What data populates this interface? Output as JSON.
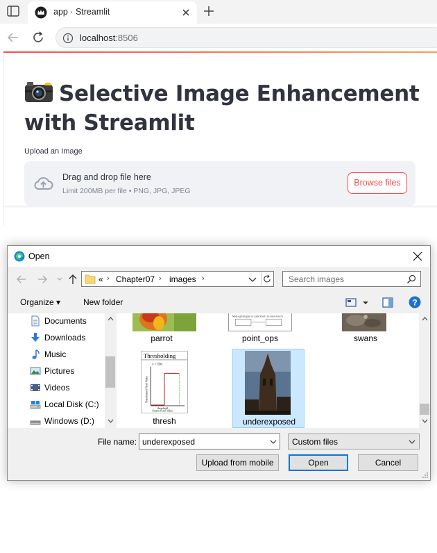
{
  "browser": {
    "tab_title": "app · Streamlit",
    "url_host": "localhost",
    "url_port": ":8506"
  },
  "page": {
    "title": "Selective Image Enhancement with Streamlit",
    "upload_label": "Upload an Image",
    "dropzone_title": "Drag and drop file here",
    "dropzone_limit": "Limit 200MB per file • PNG, JPG, JPEG",
    "browse_label": "Browse files",
    "accent_color": "#ff4b4b"
  },
  "dialog": {
    "title": "Open",
    "path": [
      "Chapter07",
      "images"
    ],
    "path_overflow": "«",
    "search_placeholder": "Search images",
    "organize_label": "Organize ▾",
    "new_folder_label": "New folder",
    "nav_items": [
      {
        "label": "Documents",
        "icon": "documents-icon"
      },
      {
        "label": "Downloads",
        "icon": "downloads-icon"
      },
      {
        "label": "Music",
        "icon": "music-icon"
      },
      {
        "label": "Pictures",
        "icon": "pictures-icon"
      },
      {
        "label": "Videos",
        "icon": "videos-icon"
      },
      {
        "label": "Local Disk (C:)",
        "icon": "local-disk-icon"
      },
      {
        "label": "Windows (D:)",
        "icon": "drive-icon"
      }
    ],
    "files": [
      {
        "label": "parrot",
        "selected": false
      },
      {
        "label": "point_ops",
        "selected": false
      },
      {
        "label": "swans",
        "selected": false
      },
      {
        "label": "thresh",
        "selected": false
      },
      {
        "label": "underexposed",
        "selected": true
      }
    ],
    "thumb_text": {
      "thresholding": "Thresholding",
      "s_eq": "s = T(r)",
      "threshold": "threshold",
      "xaxis": "Source Pixel Value",
      "yaxis": "Transformed Pixel Value",
      "point_ops_text": "Map a given gray or color level r to a new level s"
    },
    "file_name_label": "File name:",
    "file_name_value": "underexposed",
    "filter_value": "Custom files",
    "upload_mobile_label": "Upload from mobile",
    "open_label": "Open",
    "cancel_label": "Cancel"
  }
}
